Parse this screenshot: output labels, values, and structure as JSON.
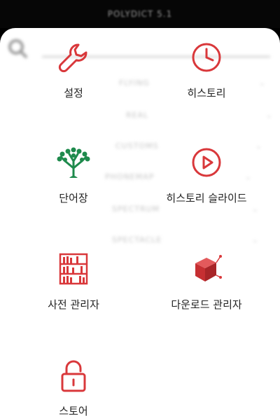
{
  "app": {
    "title": "POLYDICT 5.1"
  },
  "background_menu": {
    "items": [
      "FLYING",
      "REAL",
      "CUSTOMS",
      "PHONEMAP",
      "SPECTRUM",
      "SPECTACLE"
    ]
  },
  "menu": {
    "items": [
      {
        "label": "설정",
        "icon": "wrench-icon"
      },
      {
        "label": "히스토리",
        "icon": "clock-icon"
      },
      {
        "label": "단어장",
        "icon": "tree-icon"
      },
      {
        "label": "히스토리 슬라이드",
        "icon": "play-circle-icon"
      },
      {
        "label": "사전 관리자",
        "icon": "bookshelf-icon"
      },
      {
        "label": "다운로드 관리자",
        "icon": "cube-icon"
      },
      {
        "label": "스토어",
        "icon": "lock-icon"
      }
    ]
  },
  "colors": {
    "accent": "#d9383b",
    "tree": "#1e8a4c",
    "label": "#222222"
  }
}
